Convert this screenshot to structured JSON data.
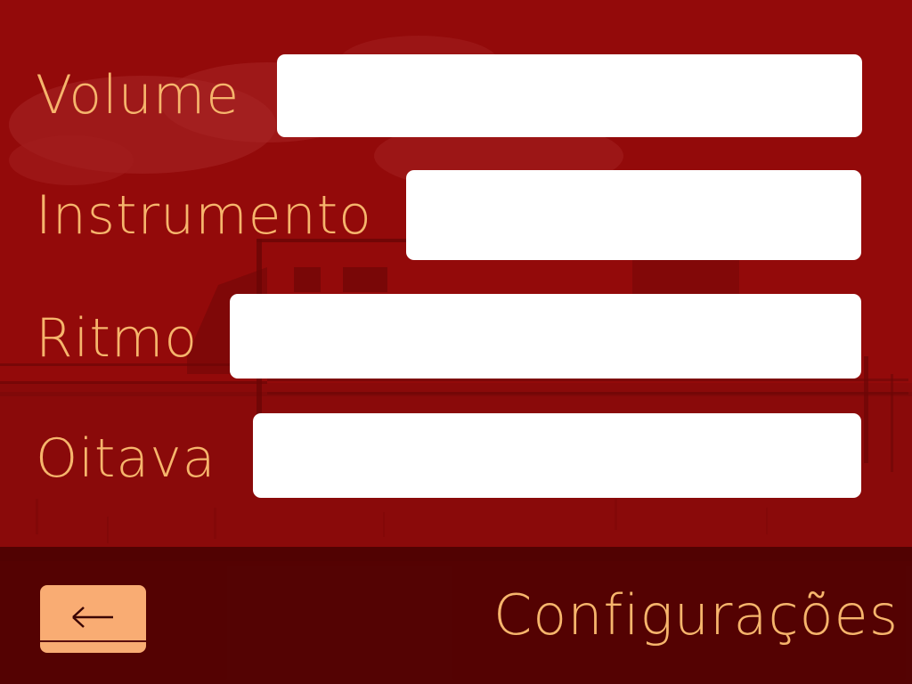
{
  "fields": [
    {
      "label": "Volume",
      "value": ""
    },
    {
      "label": "Instrumento",
      "value": ""
    },
    {
      "label": "Ritmo",
      "value": ""
    },
    {
      "label": "Oitava",
      "value": ""
    }
  ],
  "footer": {
    "back_icon": "arrow-left-icon",
    "title": "Configurações"
  },
  "colors": {
    "background": "#8e0b0b",
    "accent": "#f6b56c",
    "button": "#f9ac73",
    "footer": "#3c0000"
  }
}
